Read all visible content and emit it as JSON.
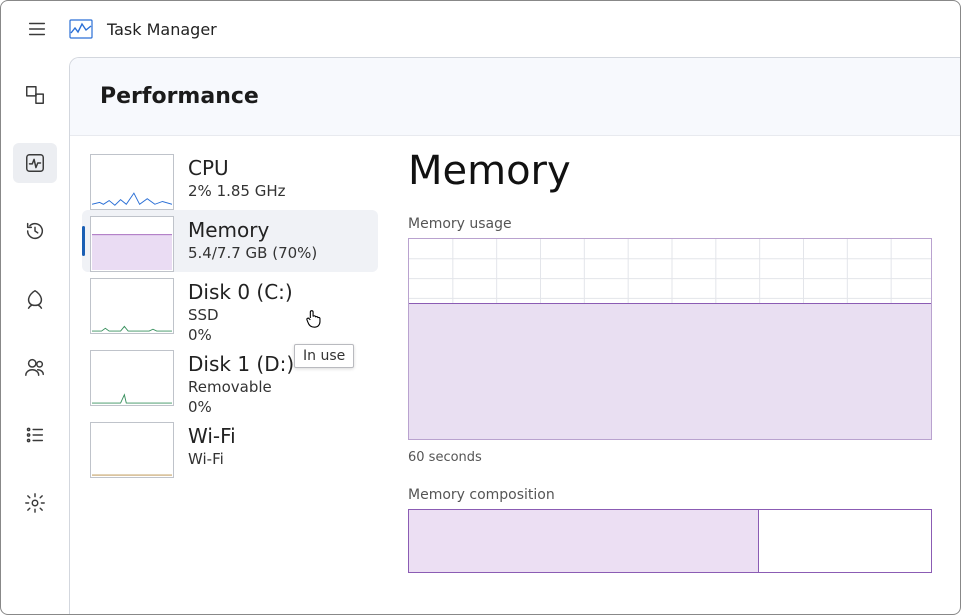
{
  "app": {
    "title": "Task Manager"
  },
  "header": {
    "page": "Performance"
  },
  "sidebar": {
    "items": [
      {
        "title": "CPU",
        "sub": "2%  1.85 GHz"
      },
      {
        "title": "Memory",
        "sub": "5.4/7.7 GB (70%)"
      },
      {
        "title": "Disk 0 (C:)",
        "sub": "SSD",
        "sub2": "0%"
      },
      {
        "title": "Disk 1 (D:)",
        "sub": "Removable",
        "sub2": "0%"
      },
      {
        "title": "Wi-Fi",
        "sub": "Wi-Fi"
      }
    ]
  },
  "detail": {
    "title": "Memory",
    "usage_label": "Memory usage",
    "axis_left": "60 seconds",
    "compo_label": "Memory composition"
  },
  "tooltip": {
    "text": "In use"
  },
  "chart_data": {
    "type": "area",
    "title": "Memory usage",
    "xlabel": "60 seconds",
    "ylabel": "",
    "ylim": [
      0,
      7.7
    ],
    "x": [
      60,
      55,
      50,
      45,
      40,
      35,
      30,
      25,
      20,
      15,
      10,
      5,
      0
    ],
    "series": [
      {
        "name": "In use (GB)",
        "values": [
          5.4,
          5.4,
          5.4,
          5.4,
          5.4,
          5.4,
          5.4,
          5.4,
          5.4,
          5.4,
          5.4,
          5.4,
          5.4
        ]
      }
    ],
    "composition": {
      "in_use_gb": 5.4,
      "total_gb": 7.7
    }
  }
}
